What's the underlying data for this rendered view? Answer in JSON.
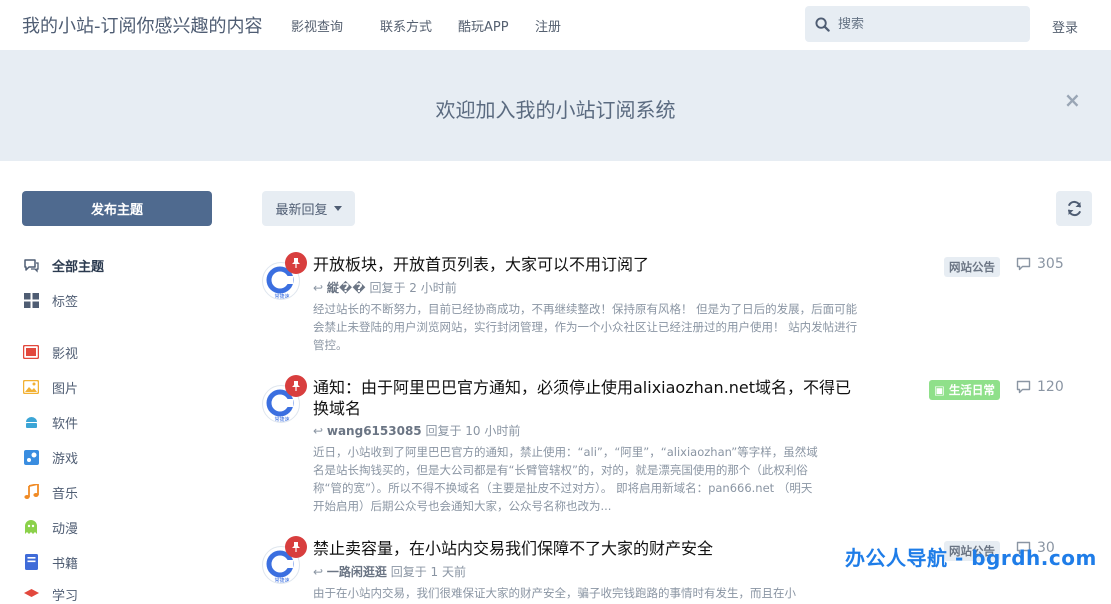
{
  "header": {
    "site_title": "我的小站-订阅你感兴趣的内容",
    "nav": [
      "影视查询",
      "联系方式",
      "酷玩APP",
      "注册"
    ],
    "search_placeholder": "搜索",
    "login": "登录"
  },
  "hero": {
    "text": "欢迎加入我的小站订阅系统",
    "close": "×"
  },
  "sidebar": {
    "start_discussion": "发布主题",
    "items": [
      {
        "label": "全部主题",
        "icon": "comments-icon",
        "color": "#4f5d73"
      },
      {
        "label": "标签",
        "icon": "grid-icon",
        "color": "#4f5d73"
      },
      {
        "label": "影视",
        "icon": "film-icon",
        "color": "#e2483d"
      },
      {
        "label": "图片",
        "icon": "image-icon",
        "color": "#f2b134"
      },
      {
        "label": "软件",
        "icon": "android-icon",
        "color": "#3ba5d6"
      },
      {
        "label": "游戏",
        "icon": "steam-icon",
        "color": "#3a8de0"
      },
      {
        "label": "音乐",
        "icon": "music-icon",
        "color": "#f08a24"
      },
      {
        "label": "动漫",
        "icon": "ghost-icon",
        "color": "#8bd14a"
      },
      {
        "label": "书籍",
        "icon": "book-icon",
        "color": "#3f6bd8"
      },
      {
        "label": "学习",
        "icon": "study-icon",
        "color": "#e2483d"
      }
    ]
  },
  "toolbar": {
    "sort_label": "最新回复",
    "refresh_icon": "refresh-icon"
  },
  "discussions": [
    {
      "title": "开放板块，开放首页列表，大家可以不用订阅了",
      "user": "縦��",
      "meta": "回复于 2 小时前",
      "excerpt": "经过站长的不断努力，目前已经协商成功，不再继续整改！保持原有风格！ 但是为了日后的发展，后面可能会禁止未登陆的用户浏览网站，实行封闭管理，作为一个小众社区让已经注册过的用户使用！ 站内发帖进行管控。",
      "tag": "网站公告",
      "tag_color": "#e7edf3",
      "replies": "305"
    },
    {
      "title": "通知：由于阿里巴巴官方通知，必须停止使用alixiaozhan.net域名，不得已换域名",
      "user": "wang6153085",
      "meta": "回复于 10 小时前",
      "excerpt": "近日，小站收到了阿里巴巴官方的通知，禁止使用：“ali”，“阿里”，“alixiaozhan”等字样，虽然域名是站长掏钱买的，但是大公司都是有“长臂管辖权”的，对的，就是漂亮国使用的那个（此权利俗称“管的宽”）。所以不得不换域名（主要是扯皮不过对方）。 即将启用新域名：pan666.net （明天开始启用）后期公众号也会通知大家，公众号名称也改为...",
      "tag": "生活日常",
      "tag_color": "#8fe08a",
      "replies": "120"
    },
    {
      "title": "禁止卖容量，在小站内交易我们保障不了大家的财产安全",
      "user": "一路闲逛逛",
      "meta": "回复于 1 天前",
      "excerpt": "由于在小站内交易，我们很难保证大家的财产安全，骗子收完钱跑路的事情时有发生，而且在小",
      "tag": "网站公告",
      "tag_color": "#e7edf3",
      "replies": "30"
    }
  ],
  "avatar_text": "常捷速",
  "watermark": "办公人导航 - bgrdh.com"
}
